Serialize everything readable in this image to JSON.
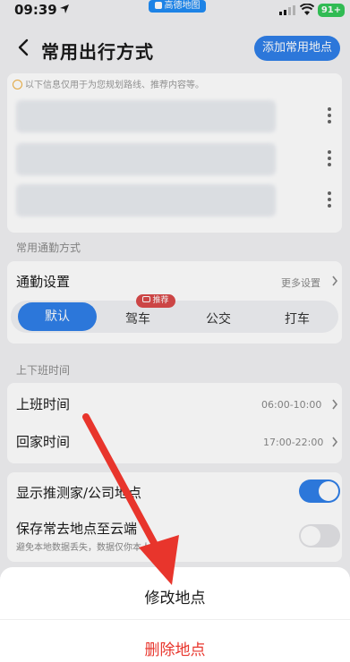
{
  "status_bar": {
    "time": "09:39",
    "app_name": "高德地图",
    "battery": "91+"
  },
  "header": {
    "title": "常用出行方式",
    "add_button": "添加常用地点"
  },
  "notice": {
    "text": "以下信息仅用于为您规划路线、推荐内容等。"
  },
  "commute": {
    "section_title": "常用通勤方式",
    "settings_label": "通勤设置",
    "more_settings": "更多设置",
    "tabs": [
      {
        "label": "默认",
        "selected": true
      },
      {
        "label": "驾车",
        "badge": "推荐"
      },
      {
        "label": "公交"
      },
      {
        "label": "打车"
      }
    ]
  },
  "hours": {
    "section_title": "上下班时间",
    "work": {
      "label": "上班时间",
      "value": "06:00-10:00"
    },
    "home": {
      "label": "回家时间",
      "value": "17:00-22:00"
    }
  },
  "options": {
    "show_guess": {
      "label": "显示推测家/公司地点",
      "on": true
    },
    "save_cloud": {
      "label": "保存常去地点至云端",
      "sub": "避免本地数据丢失，数据仅你本人可见",
      "on": false
    }
  },
  "sheet": {
    "edit": "修改地点",
    "delete": "删除地点"
  },
  "colors": {
    "accent": "#2f7fe8",
    "danger": "#e8352c",
    "toggle_on": "#2f7fe8",
    "arrow": "#e8352c"
  }
}
